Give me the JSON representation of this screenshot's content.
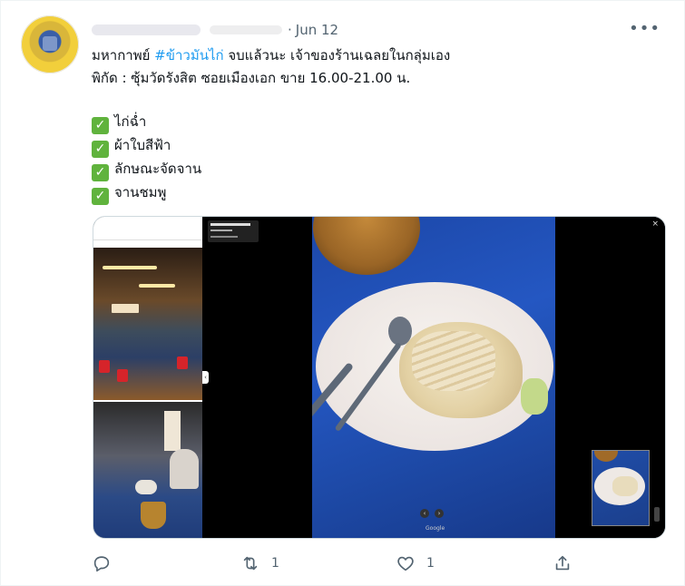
{
  "tweet": {
    "date": "Jun 12",
    "separator": "·",
    "more_label": "•••",
    "lines": {
      "line1_pre": "มหากาพย์ ",
      "hashtag": "#ข้าวมันไก่",
      "line1_post": " จบแล้วนะ เจ้าของร้านเฉลยในกลุ่มเอง",
      "line2": "พิกัด : ซุ้มวัดรังสิต ซอยเมืองเอก ขาย 16.00-21.00 น."
    },
    "check_mark": "✓",
    "checklist": [
      "ไก่ฉ่ำ",
      "ผ้าใบสีฟ้า",
      "ลักษณะจัดจาน",
      "จานชมพู"
    ],
    "media": {
      "google_label": "Google",
      "close_label": "×",
      "prev_label": "‹",
      "next_label": "›",
      "collapse_label": "‹"
    },
    "actions": {
      "reply_count": "",
      "retweet_count": "1",
      "like_count": "1",
      "share_count": ""
    }
  }
}
